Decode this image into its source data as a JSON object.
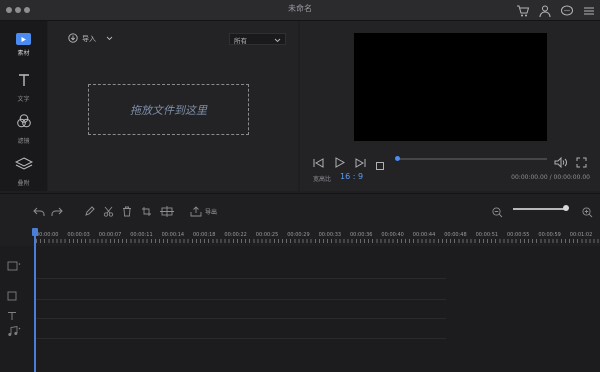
{
  "window": {
    "title": "未命名"
  },
  "titlebar_icons": [
    "cart-icon",
    "user-icon",
    "chat-icon",
    "menu-icon"
  ],
  "sidebar": {
    "items": [
      {
        "label": "素材",
        "icon": "media-icon",
        "active": true
      },
      {
        "label": "文字",
        "icon": "text-icon",
        "active": false
      },
      {
        "label": "滤镜",
        "icon": "filter-icon",
        "active": false
      },
      {
        "label": "叠附",
        "icon": "overlay-icon",
        "active": false
      }
    ]
  },
  "media": {
    "import_label": "导入",
    "filter_value": "所有",
    "drop_hint": "拖放文件到这里"
  },
  "preview": {
    "ratio_label": "宽高比",
    "ratio_value": "16 : 9",
    "timecode": "00:00:00.00 / 00:00:00.00",
    "progress": 0
  },
  "toolbar": {
    "export_label": "导出",
    "zoom_level": 1.0
  },
  "ruler": {
    "labels": [
      "00:00:00",
      "00:00:03",
      "00:00:07",
      "00:00:11",
      "00:00:14",
      "00:00:18",
      "00:00:22",
      "00:00:25",
      "00:00:29",
      "00:00:33",
      "00:00:36",
      "00:00:40",
      "00:00:44",
      "00:00:48",
      "00:00:51",
      "00:00:55",
      "00:00:59",
      "00:01:02"
    ]
  },
  "colors": {
    "accent": "#4a8cf0",
    "video_bg": "#000000"
  }
}
